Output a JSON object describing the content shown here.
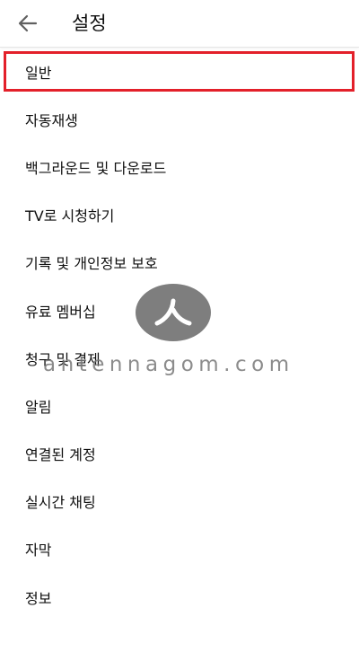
{
  "header": {
    "title": "설정",
    "back_icon": "arrow-left-icon"
  },
  "menu": {
    "items": [
      {
        "label": "일반"
      },
      {
        "label": "자동재생"
      },
      {
        "label": "백그라운드 및 다운로드"
      },
      {
        "label": "TV로 시청하기"
      },
      {
        "label": "기록 및 개인정보 보호"
      },
      {
        "label": "유료 멤버십"
      },
      {
        "label": "청구 및 결제"
      },
      {
        "label": "알림"
      },
      {
        "label": "연결된 계정"
      },
      {
        "label": "실시간 채팅"
      },
      {
        "label": "자막"
      },
      {
        "label": "정보"
      }
    ]
  },
  "watermark": {
    "text": "antennagom.com",
    "logo_glyph": "ㅅ"
  },
  "colors": {
    "highlight": "#e3202a",
    "text": "#0f0f0f",
    "icon": "#606060"
  }
}
